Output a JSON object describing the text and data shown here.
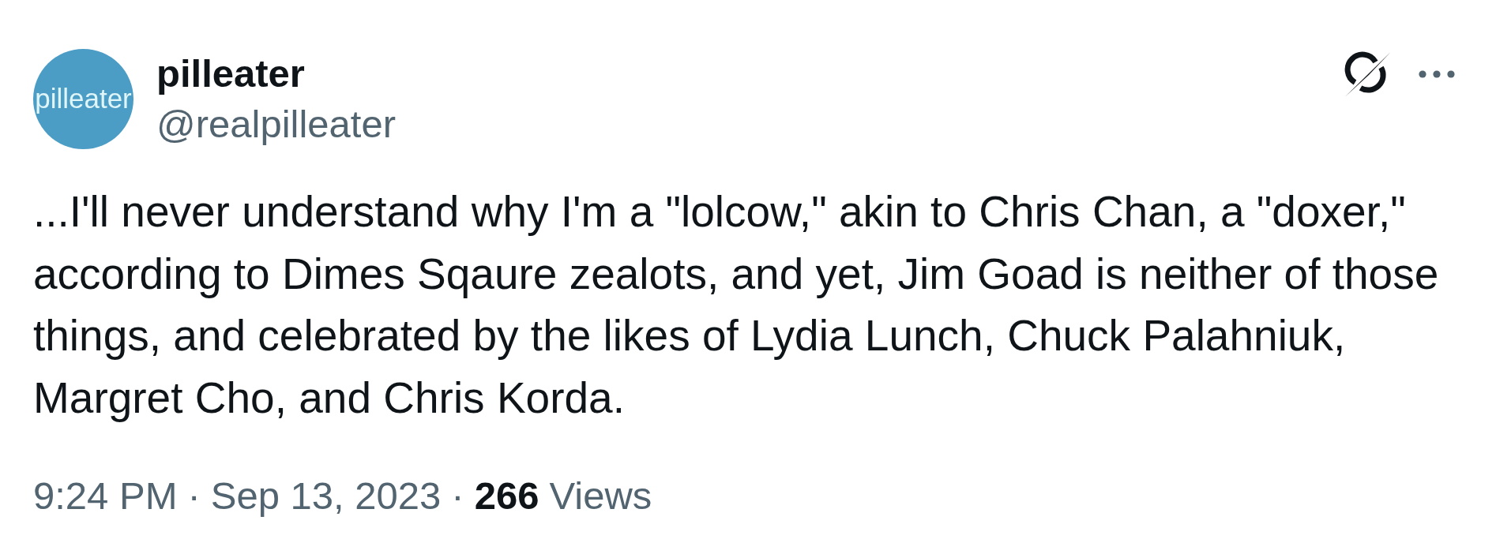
{
  "author": {
    "avatar_text": "pilleater",
    "name": "pilleater",
    "handle": "@realpilleater"
  },
  "tweet": {
    "text": "...I'll never understand why I'm a \"lolcow,\" akin to Chris Chan, a \"doxer,\" according to Dimes Sqaure zealots, and yet, Jim Goad is neither of those things, and celebrated by the likes of Lydia Lunch, Chuck Palahniuk, Margret Cho, and Chris Korda."
  },
  "footer": {
    "time": "9:24 PM",
    "separator_1": "·",
    "date": "Sep 13, 2023",
    "separator_2": "·",
    "views_count": "266",
    "views_label": "Views"
  }
}
